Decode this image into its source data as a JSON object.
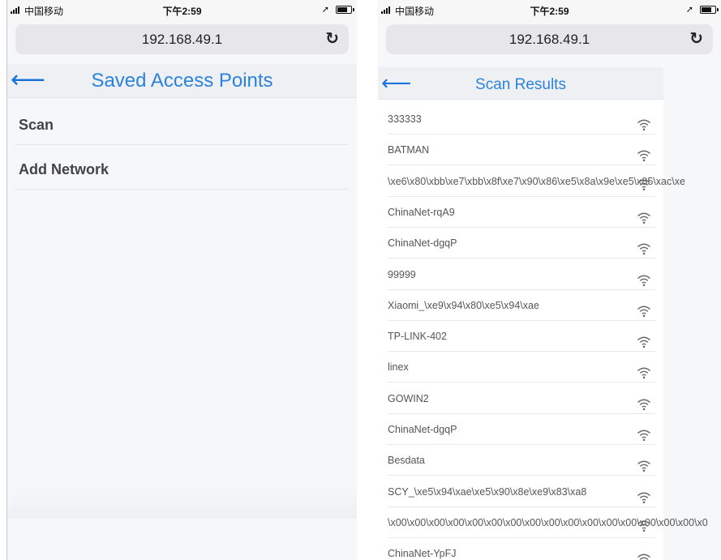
{
  "status_bar": {
    "carrier": "中国移动",
    "time": "下午2:59",
    "location_icon": "location-arrow-icon",
    "battery_icon": "battery-icon"
  },
  "browser": {
    "url": "192.168.49.1",
    "reload_icon": "reload-icon"
  },
  "left_screen": {
    "back_icon": "back-arrow-icon",
    "title": "Saved Access Points",
    "menu_items": [
      {
        "label": "Scan"
      },
      {
        "label": "Add Network"
      }
    ]
  },
  "right_screen": {
    "back_icon": "back-arrow-icon",
    "title": "Scan Results",
    "networks": [
      {
        "ssid": "333333",
        "icon": "wifi-icon"
      },
      {
        "ssid": "BATMAN",
        "icon": "wifi-icon"
      },
      {
        "ssid": "\\xe6\\x80\\xbb\\xe7\\xbb\\x8f\\xe7\\x90\\x86\\xe5\\x8a\\x9e\\xe5\\x85\\xac\\xe",
        "icon": "wifi-icon"
      },
      {
        "ssid": "ChinaNet-rqA9",
        "icon": "wifi-icon"
      },
      {
        "ssid": "ChinaNet-dgqP",
        "icon": "wifi-icon"
      },
      {
        "ssid": "99999",
        "icon": "wifi-icon"
      },
      {
        "ssid": "Xiaomi_\\xe9\\x94\\x80\\xe5\\x94\\xae",
        "icon": "wifi-icon"
      },
      {
        "ssid": "TP-LINK-402",
        "icon": "wifi-icon"
      },
      {
        "ssid": "linex",
        "icon": "wifi-icon"
      },
      {
        "ssid": "GOWIN2",
        "icon": "wifi-icon"
      },
      {
        "ssid": "ChinaNet-dgqP",
        "icon": "wifi-icon"
      },
      {
        "ssid": "Besdata",
        "icon": "wifi-icon"
      },
      {
        "ssid": "SCY_\\xe5\\x94\\xae\\xe5\\x90\\x8e\\xe9\\x83\\xa8",
        "icon": "wifi-icon"
      },
      {
        "ssid": "\\x00\\x00\\x00\\x00\\x00\\x00\\x00\\x00\\x00\\x00\\x00\\x00\\x00\\x00\\x00\\x00\\x0",
        "icon": "wifi-icon"
      },
      {
        "ssid": "ChinaNet-YpFJ",
        "icon": "wifi-icon"
      }
    ]
  },
  "colors": {
    "accent": "#2b83db",
    "back_arrow": "#1a73d9",
    "background": "#f6f7f9",
    "url_bar": "#e7e7ea"
  }
}
